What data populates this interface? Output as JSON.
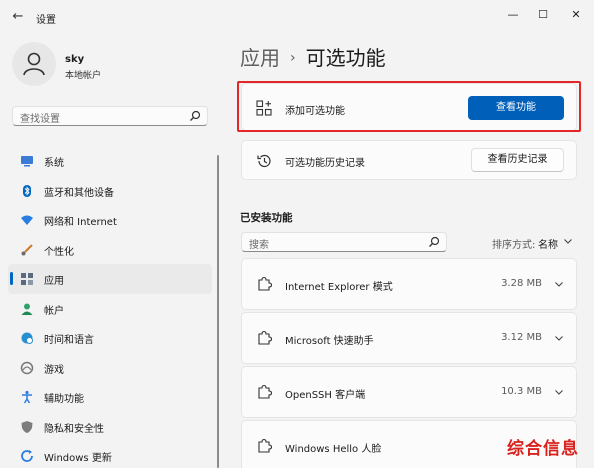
{
  "window": {
    "title": "设置"
  },
  "user": {
    "name": "sky",
    "account_type": "本地帐户"
  },
  "sidebar": {
    "search_placeholder": "查找设置",
    "items": [
      {
        "label": "系统",
        "icon": "monitor-icon",
        "color": "#3a7bd5"
      },
      {
        "label": "蓝牙和其他设备",
        "icon": "bluetooth-icon",
        "color": "#0067c0"
      },
      {
        "label": "网络和 Internet",
        "icon": "wifi-icon",
        "color": "#2a7de1"
      },
      {
        "label": "个性化",
        "icon": "brush-icon",
        "color": "#c97a2a"
      },
      {
        "label": "应用",
        "icon": "apps-icon",
        "color": "#5a6b80",
        "active": true
      },
      {
        "label": "帐户",
        "icon": "account-icon",
        "color": "#2fa36b"
      },
      {
        "label": "时间和语言",
        "icon": "globe-clock-icon",
        "color": "#2a8fd0"
      },
      {
        "label": "游戏",
        "icon": "gamepad-icon",
        "color": "#777777"
      },
      {
        "label": "辅助功能",
        "icon": "accessibility-icon",
        "color": "#2a7de1"
      },
      {
        "label": "隐私和安全性",
        "icon": "shield-icon",
        "color": "#6b6b6b"
      },
      {
        "label": "Windows 更新",
        "icon": "update-icon",
        "color": "#2a7de1"
      }
    ]
  },
  "breadcrumb": {
    "parent": "应用",
    "separator": "›",
    "current": "可选功能"
  },
  "add_feature": {
    "label": "添加可选功能",
    "button": "查看功能"
  },
  "history": {
    "label": "可选功能历史记录",
    "button": "查看历史记录"
  },
  "installed": {
    "title": "已安装功能",
    "search_placeholder": "搜索",
    "sort_label": "排序方式:",
    "sort_value": "名称",
    "items": [
      {
        "name": "Internet Explorer 模式",
        "size": "3.28 MB"
      },
      {
        "name": "Microsoft 快速助手",
        "size": "3.12 MB"
      },
      {
        "name": "OpenSSH 客户端",
        "size": "10.3 MB"
      },
      {
        "name": "Windows Hello 人脸",
        "size": ""
      }
    ]
  },
  "watermark": "综合信息",
  "colors": {
    "accent": "#005fb8",
    "highlight_border": "#e52628",
    "watermark": "#d9221d"
  }
}
